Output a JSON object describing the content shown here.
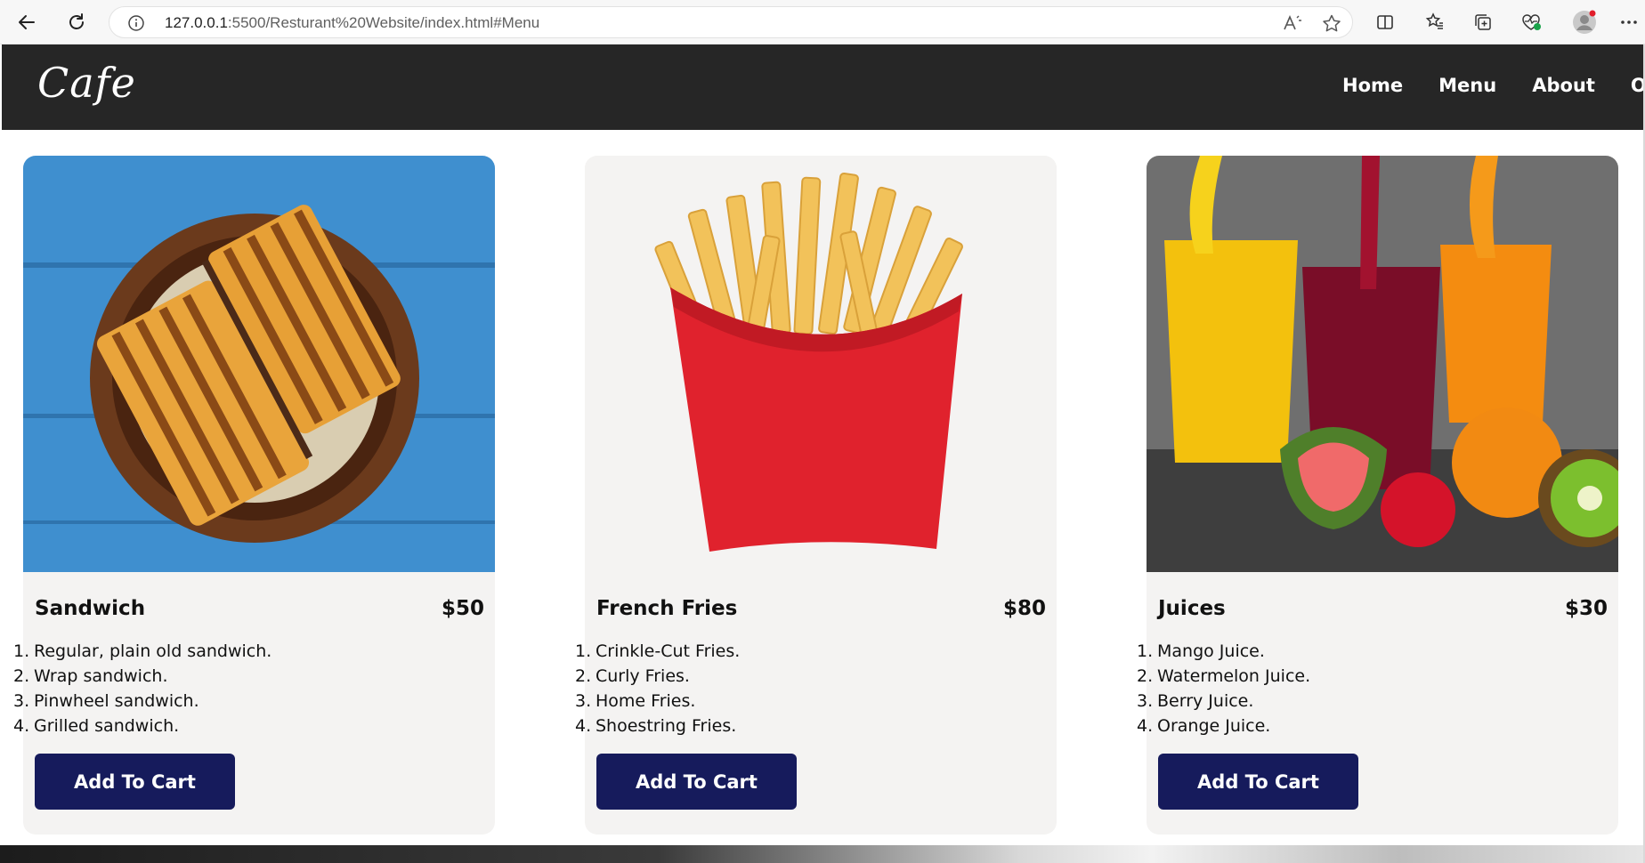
{
  "browser": {
    "url_host": "127.0.0.1",
    "url_rest": ":5500/Resturant%20Website/index.html#Menu",
    "icons": [
      "back-arrow-icon",
      "refresh-icon",
      "info-icon",
      "read-aloud-icon",
      "favorite-star-icon",
      "split-screen-icon",
      "favorites-icon",
      "collections-icon",
      "browser-essentials-icon",
      "profile-avatar-icon",
      "more-options-icon"
    ]
  },
  "navbar": {
    "brand": "Cafe",
    "links": [
      "Home",
      "Menu",
      "About",
      "Order"
    ]
  },
  "cards": [
    {
      "title": "Sandwich",
      "price": "$50",
      "items": [
        "Regular, plain old sandwich.",
        "Wrap sandwich.",
        "Pinwheel sandwich.",
        "Grilled sandwich."
      ],
      "button": "Add To Cart"
    },
    {
      "title": "French Fries",
      "price": "$80",
      "items": [
        "Crinkle-Cut Fries.",
        "Curly Fries.",
        "Home Fries.",
        "Shoestring Fries."
      ],
      "button": "Add To Cart"
    },
    {
      "title": "Juices",
      "price": "$30",
      "items": [
        "Mango Juice.",
        "Watermelon Juice.",
        "Berry Juice.",
        "Orange Juice."
      ],
      "button": "Add To Cart"
    }
  ],
  "colors": {
    "navbar_bg": "#262626",
    "card_bg": "#f4f3f2",
    "button_bg": "#161b5c"
  }
}
